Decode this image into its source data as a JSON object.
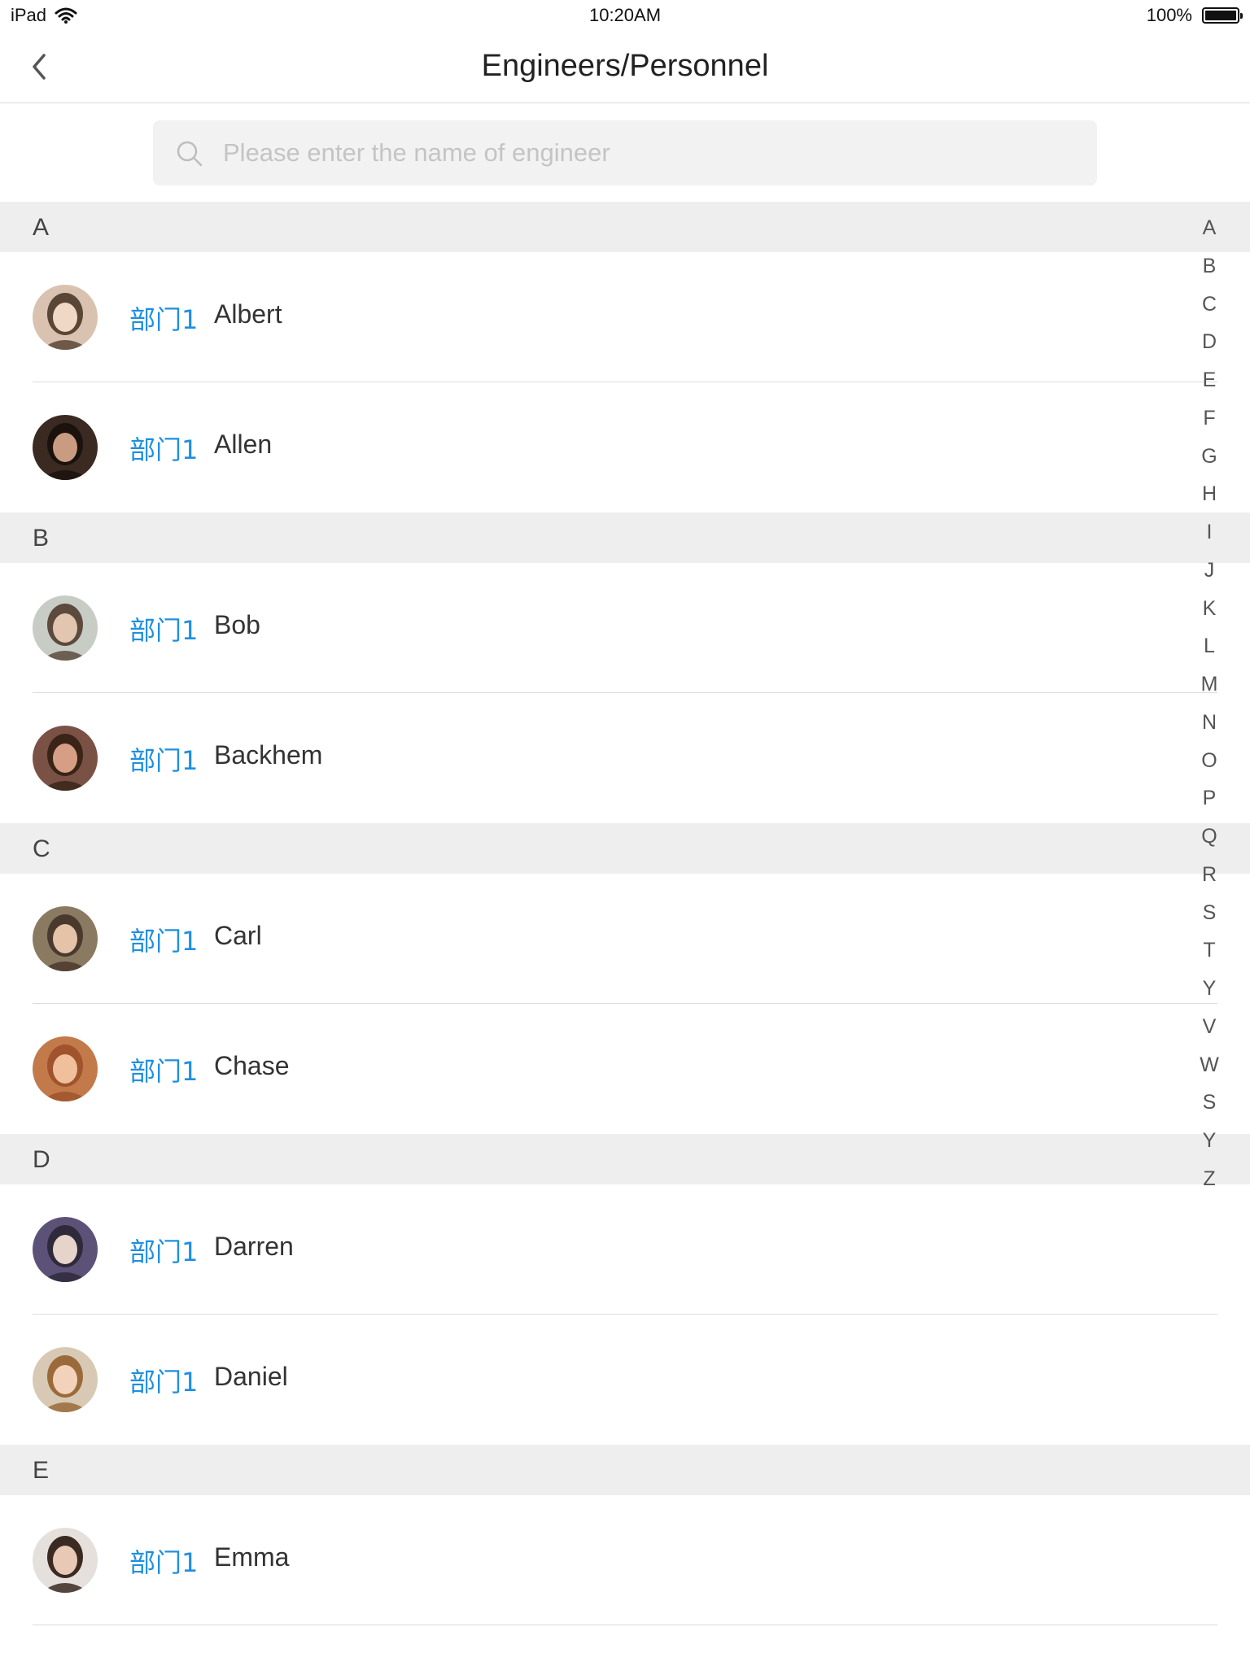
{
  "status_bar": {
    "device": "iPad",
    "time": "10:20AM",
    "battery": "100%",
    "battery_level": 1.0
  },
  "nav": {
    "title": "Engineers/Personnel",
    "back_icon": "chevron-left-icon"
  },
  "search": {
    "placeholder": "Please enter the name of engineer",
    "value": "",
    "icon": "search-icon"
  },
  "sections": [
    {
      "letter": "A",
      "people": [
        {
          "dept": "部门1",
          "name": "Albert",
          "avatar_colors": [
            "#d9c2b0",
            "#5a4636",
            "#f0d8c6"
          ]
        },
        {
          "dept": "部门1",
          "name": "Allen",
          "avatar_colors": [
            "#3b2a22",
            "#1b120e",
            "#c99c82"
          ]
        }
      ]
    },
    {
      "letter": "B",
      "people": [
        {
          "dept": "部门1",
          "name": "Bob",
          "avatar_colors": [
            "#c7ccc5",
            "#5b4a3d",
            "#e2c6b0"
          ]
        },
        {
          "dept": "部门1",
          "name": "Backhem",
          "avatar_colors": [
            "#7a5245",
            "#3a2418",
            "#d79e86"
          ]
        }
      ]
    },
    {
      "letter": "C",
      "people": [
        {
          "dept": "部门1",
          "name": "Carl",
          "avatar_colors": [
            "#8b7a62",
            "#4a3a2e",
            "#e5c3a8"
          ]
        },
        {
          "dept": "部门1",
          "name": "Chase",
          "avatar_colors": [
            "#c27a4a",
            "#a0532c",
            "#f0c09c"
          ]
        }
      ]
    },
    {
      "letter": "D",
      "people": [
        {
          "dept": "部门1",
          "name": "Darren",
          "avatar_colors": [
            "#5c5277",
            "#2e2a3c",
            "#e6d3c9"
          ]
        },
        {
          "dept": "部门1",
          "name": "Daniel",
          "avatar_colors": [
            "#d8c9b4",
            "#9a6a3a",
            "#f2d2bb"
          ]
        }
      ]
    },
    {
      "letter": "E",
      "people": [
        {
          "dept": "部门1",
          "name": "Emma",
          "avatar_colors": [
            "#e6e0dc",
            "#3a2a22",
            "#e8c9b6"
          ]
        }
      ]
    }
  ],
  "alphabet_index": [
    "A",
    "B",
    "C",
    "D",
    "E",
    "F",
    "G",
    "H",
    "I",
    "J",
    "K",
    "L",
    "M",
    "N",
    "O",
    "P",
    "Q",
    "R",
    "S",
    "T",
    "Y",
    "V",
    "W",
    "S",
    "Y",
    "Z"
  ]
}
